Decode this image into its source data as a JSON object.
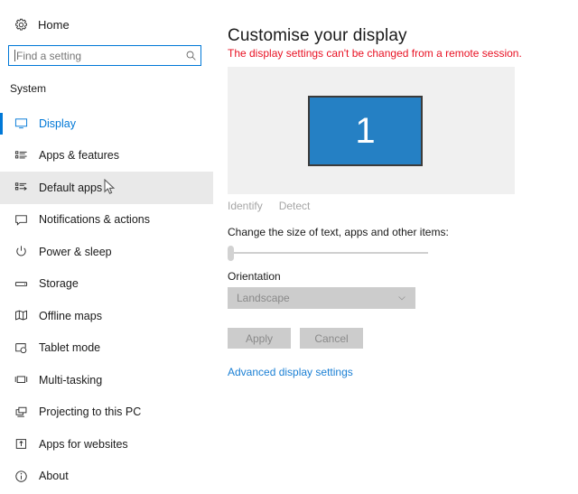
{
  "sidebar": {
    "home": {
      "label": "Home",
      "icon": "gear-icon"
    },
    "search": {
      "value": "",
      "placeholder": "Find a setting",
      "icon": "search-icon"
    },
    "section_header": "System",
    "items": [
      {
        "label": "Display",
        "icon": "monitor-icon",
        "state": "selected"
      },
      {
        "label": "Apps & features",
        "icon": "list-icon",
        "state": "normal"
      },
      {
        "label": "Default apps",
        "icon": "list-arrow-icon",
        "state": "hovered"
      },
      {
        "label": "Notifications & actions",
        "icon": "speech-bubble-icon",
        "state": "normal"
      },
      {
        "label": "Power & sleep",
        "icon": "power-icon",
        "state": "normal"
      },
      {
        "label": "Storage",
        "icon": "drive-icon",
        "state": "normal"
      },
      {
        "label": "Offline maps",
        "icon": "map-icon",
        "state": "normal"
      },
      {
        "label": "Tablet mode",
        "icon": "tablet-touch-icon",
        "state": "normal"
      },
      {
        "label": "Multi-tasking",
        "icon": "multitask-icon",
        "state": "normal"
      },
      {
        "label": "Projecting to this PC",
        "icon": "projector-icon",
        "state": "normal"
      },
      {
        "label": "Apps for websites",
        "icon": "app-link-icon",
        "state": "normal"
      },
      {
        "label": "About",
        "icon": "info-icon",
        "state": "normal"
      }
    ]
  },
  "content": {
    "title": "Customise your display",
    "warning": "The display settings can't be changed from a remote session.",
    "monitor": {
      "number": "1"
    },
    "preview_buttons": [
      {
        "label": "Identify",
        "enabled": false
      },
      {
        "label": "Detect",
        "enabled": false
      }
    ],
    "scale": {
      "label": "Change the size of text, apps and other items:",
      "slider_position_percent": 0
    },
    "orientation": {
      "label": "Orientation",
      "value": "Landscape",
      "chevron": "chevron-down-icon",
      "enabled": false
    },
    "actions": [
      {
        "label": "Apply",
        "enabled": false
      },
      {
        "label": "Cancel",
        "enabled": false
      }
    ],
    "advanced_link": "Advanced display settings"
  },
  "colors": {
    "accent_blue": "#0078d7",
    "link_blue": "#1a7fd4",
    "monitor_blue": "#2580c4",
    "warning_red": "#e81123",
    "preview_bg": "#f0f0f0",
    "hover_bg": "#e9e9e9",
    "disabled_bg": "#cccccc",
    "disabled_text": "#8a8a8a"
  }
}
